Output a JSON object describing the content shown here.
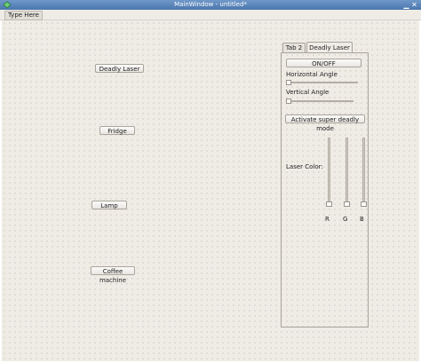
{
  "window": {
    "title": "MainWindow - untitled*"
  },
  "menubar": {
    "item": "Type Here"
  },
  "buttons": {
    "deadly_laser": "Deadly Laser",
    "fridge": "Fridge",
    "lamp": "Lamp",
    "coffee_machine": "Coffee machine"
  },
  "tabs": [
    "Tab 2",
    "Deadly Laser"
  ],
  "laser_tab": {
    "onoff": "ON/OFF",
    "horizontal_label": "Horizontal Angle",
    "vertical_label": "Vertical Angle",
    "super_mode": "Activate super deadly mode",
    "color_label": "Laser Color:",
    "channels": [
      "R",
      "G",
      "B"
    ],
    "horizontal_value": 0,
    "vertical_value": 0,
    "rgb_values": [
      0,
      0,
      0
    ]
  }
}
